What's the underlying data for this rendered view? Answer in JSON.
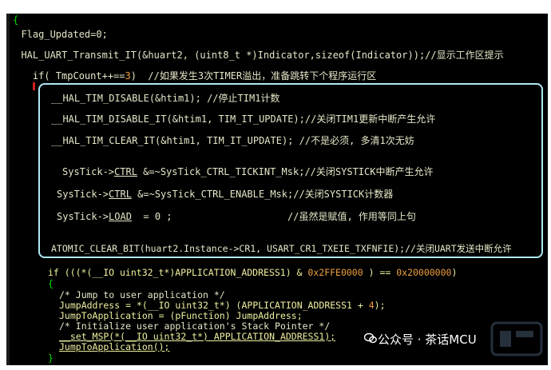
{
  "code": {
    "brace_open": "{",
    "line_flag": "  Flag_Updated=0;",
    "line_uart": "  HAL_UART_Transmit_IT(&huart2, (uint8_t *)Indicator,sizeof(Indicator));//显示工作区提示",
    "line_if_a": "    if( TmpCount++==",
    "line_if_num": "3",
    "line_if_b": ")  //如果发生3次TIMER溢出，准备跳转下个程序运行区",
    "l1": "__HAL_TIM_DISABLE(&htim1); //停止TIM1计数",
    "l2": "__HAL_TIM_DISABLE_IT(&htim1, TIM_IT_UPDATE);//关闭TIM1更新中断产生允许",
    "l3": "__HAL_TIM_CLEAR_IT(&htim1, TIM_IT_UPDATE); //不是必须, 多清1次无妨",
    "l4_a": "SysTick->",
    "l4_u": "CTRL",
    "l4_b": " &=~SysTick_CTRL_TICKINT_Msk;//关闭SYSTICK中断产生允许",
    "l5_a": "SysTick->",
    "l5_u": "CTRL",
    "l5_b": " &=~SysTick_CTRL_ENABLE_Msk;//关闭SYSTICK计数器",
    "l6_a": "SysTick->",
    "l6_u": "LOAD",
    "l6_b": "  = 0 ;                    //虽然是赋值, 作用等同上句",
    "l7": "ATOMIC_CLEAR_BIT(huart2.Instance->CR1, USART_CR1_TXEIE_TXFNFIE);//关闭UART发送中断允许",
    "if2_a": "if (((*(__IO uint32_t*)APPLICATION_ADDRESS1) & ",
    "if2_n1": "0x2FFE0000",
    "if2_b": " ) == ",
    "if2_n2": "0x20000000",
    "if2_c": ")",
    "brace2": "{",
    "c1": "/* Jump to user application */",
    "c2_a": "JumpAddress = *(__IO uint32_t*) (APPLICATION_ADDRESS1 + ",
    "c2_n": "4",
    "c2_b": ");",
    "c3": "JumpToApplication = (pFunction) JumpAddress;",
    "c4": "/* Initialize user application's Stack Pointer */",
    "c5": "__set_MSP(*(__IO uint32_t*) APPLICATION_ADDRESS1);",
    "c6": "JumpToApplication();",
    "brace3": "}"
  },
  "watermark": {
    "text": "公众号 · 茶话MCU",
    "icon": "wechat-icon"
  },
  "colors": {
    "background": "#000000",
    "highlight_border": "#aee9f4",
    "number": "#f0a040"
  }
}
